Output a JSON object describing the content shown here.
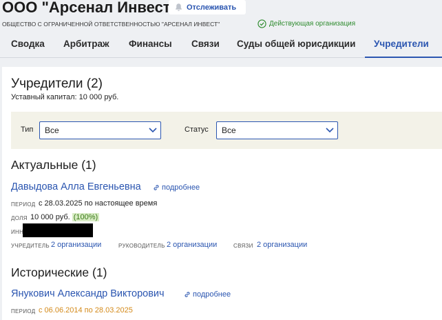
{
  "company": {
    "title": "ООО \"Арсенал Инвест\"",
    "follow_label": "Отслеживать",
    "full_name": "ОБЩЕСТВО С ОГРАНИЧЕННОЙ ОТВЕТСТВЕННОСТЬЮ \"АРСЕНАЛ ИНВЕСТ\"",
    "status": "Действующая организация"
  },
  "tabs": [
    {
      "label": "Сводка"
    },
    {
      "label": "Арбитраж"
    },
    {
      "label": "Финансы"
    },
    {
      "label": "Связи"
    },
    {
      "label": "Суды общей юрисдикции"
    },
    {
      "label": "Учредители",
      "active": true
    }
  ],
  "founders": {
    "heading": "Учредители (2)",
    "capital": "Уставный капитал: 10 000 руб.",
    "filters": {
      "type_label": "Тип",
      "type_value": "Все",
      "status_label": "Статус",
      "status_value": "Все"
    },
    "current": {
      "heading": "Актуальные (1)",
      "name": "Давыдова Алла Евгеньевна",
      "more_label": "подробнее",
      "period_label": "ПЕРИОД",
      "period_value": "с 28.03.2025 по настоящее время",
      "share_label": "ДОЛЯ",
      "share_value": "10 000 руб.",
      "share_pct": "(100%)",
      "inn_label": "ИНН",
      "founder_label": "УЧРЕДИТЕЛЬ",
      "founder_value": "2 организации",
      "manager_label": "РУКОВОДИТЕЛЬ",
      "manager_value": "2 организации",
      "links_label": "СВЯЗИ",
      "links_value": "2 организации"
    },
    "historical": {
      "heading": "Исторические (1)",
      "name": "Янукович Александр Викторович",
      "more_label": "подробнее",
      "period_label": "ПЕРИОД",
      "period_value": "с 06.06.2014 по 28.03.2025"
    }
  },
  "colors": {
    "accent": "#2a55b0",
    "status_green": "#2e8b2e",
    "history_orange": "#d48a1a",
    "filter_bg": "#f3f2e8"
  },
  "icons": {
    "follow": "bell-icon",
    "status": "check-circle-icon",
    "more": "link-icon",
    "select": "chevron-down-icon"
  }
}
